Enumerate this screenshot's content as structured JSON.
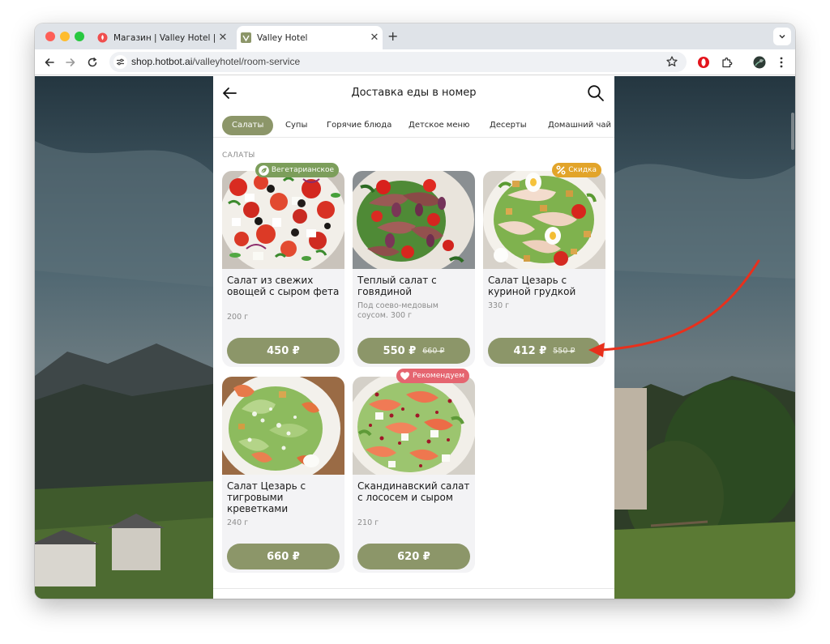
{
  "browser": {
    "tabs": [
      {
        "title": "Магазин | Valley Hotel | Hotb",
        "active": false
      },
      {
        "title": "Valley Hotel",
        "active": true
      }
    ],
    "url_host": "shop.hotbot.ai",
    "url_path": "/valleyhotel/room-service"
  },
  "header": {
    "title": "Доставка еды в номер"
  },
  "categories": [
    {
      "label": "Салаты",
      "selected": true
    },
    {
      "label": "Супы",
      "selected": false
    },
    {
      "label": "Горячие блюда",
      "selected": false
    },
    {
      "label": "Детское меню",
      "selected": false
    },
    {
      "label": "Десерты",
      "selected": false
    },
    {
      "label": "Домашний чай",
      "selected": false
    }
  ],
  "section": {
    "label": "САЛАТЫ"
  },
  "products": [
    {
      "name": "Салат из свежих овощей с сыром фета",
      "description": "",
      "weight": "200 г",
      "price": "450 ₽",
      "old_price": "",
      "badge": "Вегетарианское",
      "badge_icon": "leaf-icon"
    },
    {
      "name": "Теплый салат с говядиной",
      "description": "Под соево-медовым соусом. 300 г",
      "weight": "",
      "price": "550 ₽",
      "old_price": "660 ₽",
      "badge": "",
      "badge_icon": ""
    },
    {
      "name": "Салат Цезарь с куриной грудкой",
      "description": "",
      "weight": "330 г",
      "price": "412 ₽",
      "old_price": "550 ₽",
      "badge": "Скидка",
      "badge_icon": "percent-icon"
    },
    {
      "name": "Салат Цезарь с тигровыми креветками",
      "description": "",
      "weight": "240 г",
      "price": "660 ₽",
      "old_price": "",
      "badge": "",
      "badge_icon": ""
    },
    {
      "name": "Скандинавский салат с лососем и сыром",
      "description": "",
      "weight": "210 г",
      "price": "620 ₽",
      "old_price": "",
      "badge": "Рекомендуем",
      "badge_icon": "heart-icon"
    }
  ],
  "colors": {
    "accent": "#8c9669",
    "badge_veg": "#7c9e5b",
    "badge_sale": "#e2a42a",
    "badge_rec": "#e56570",
    "annotation_arrow": "#e8301c"
  }
}
